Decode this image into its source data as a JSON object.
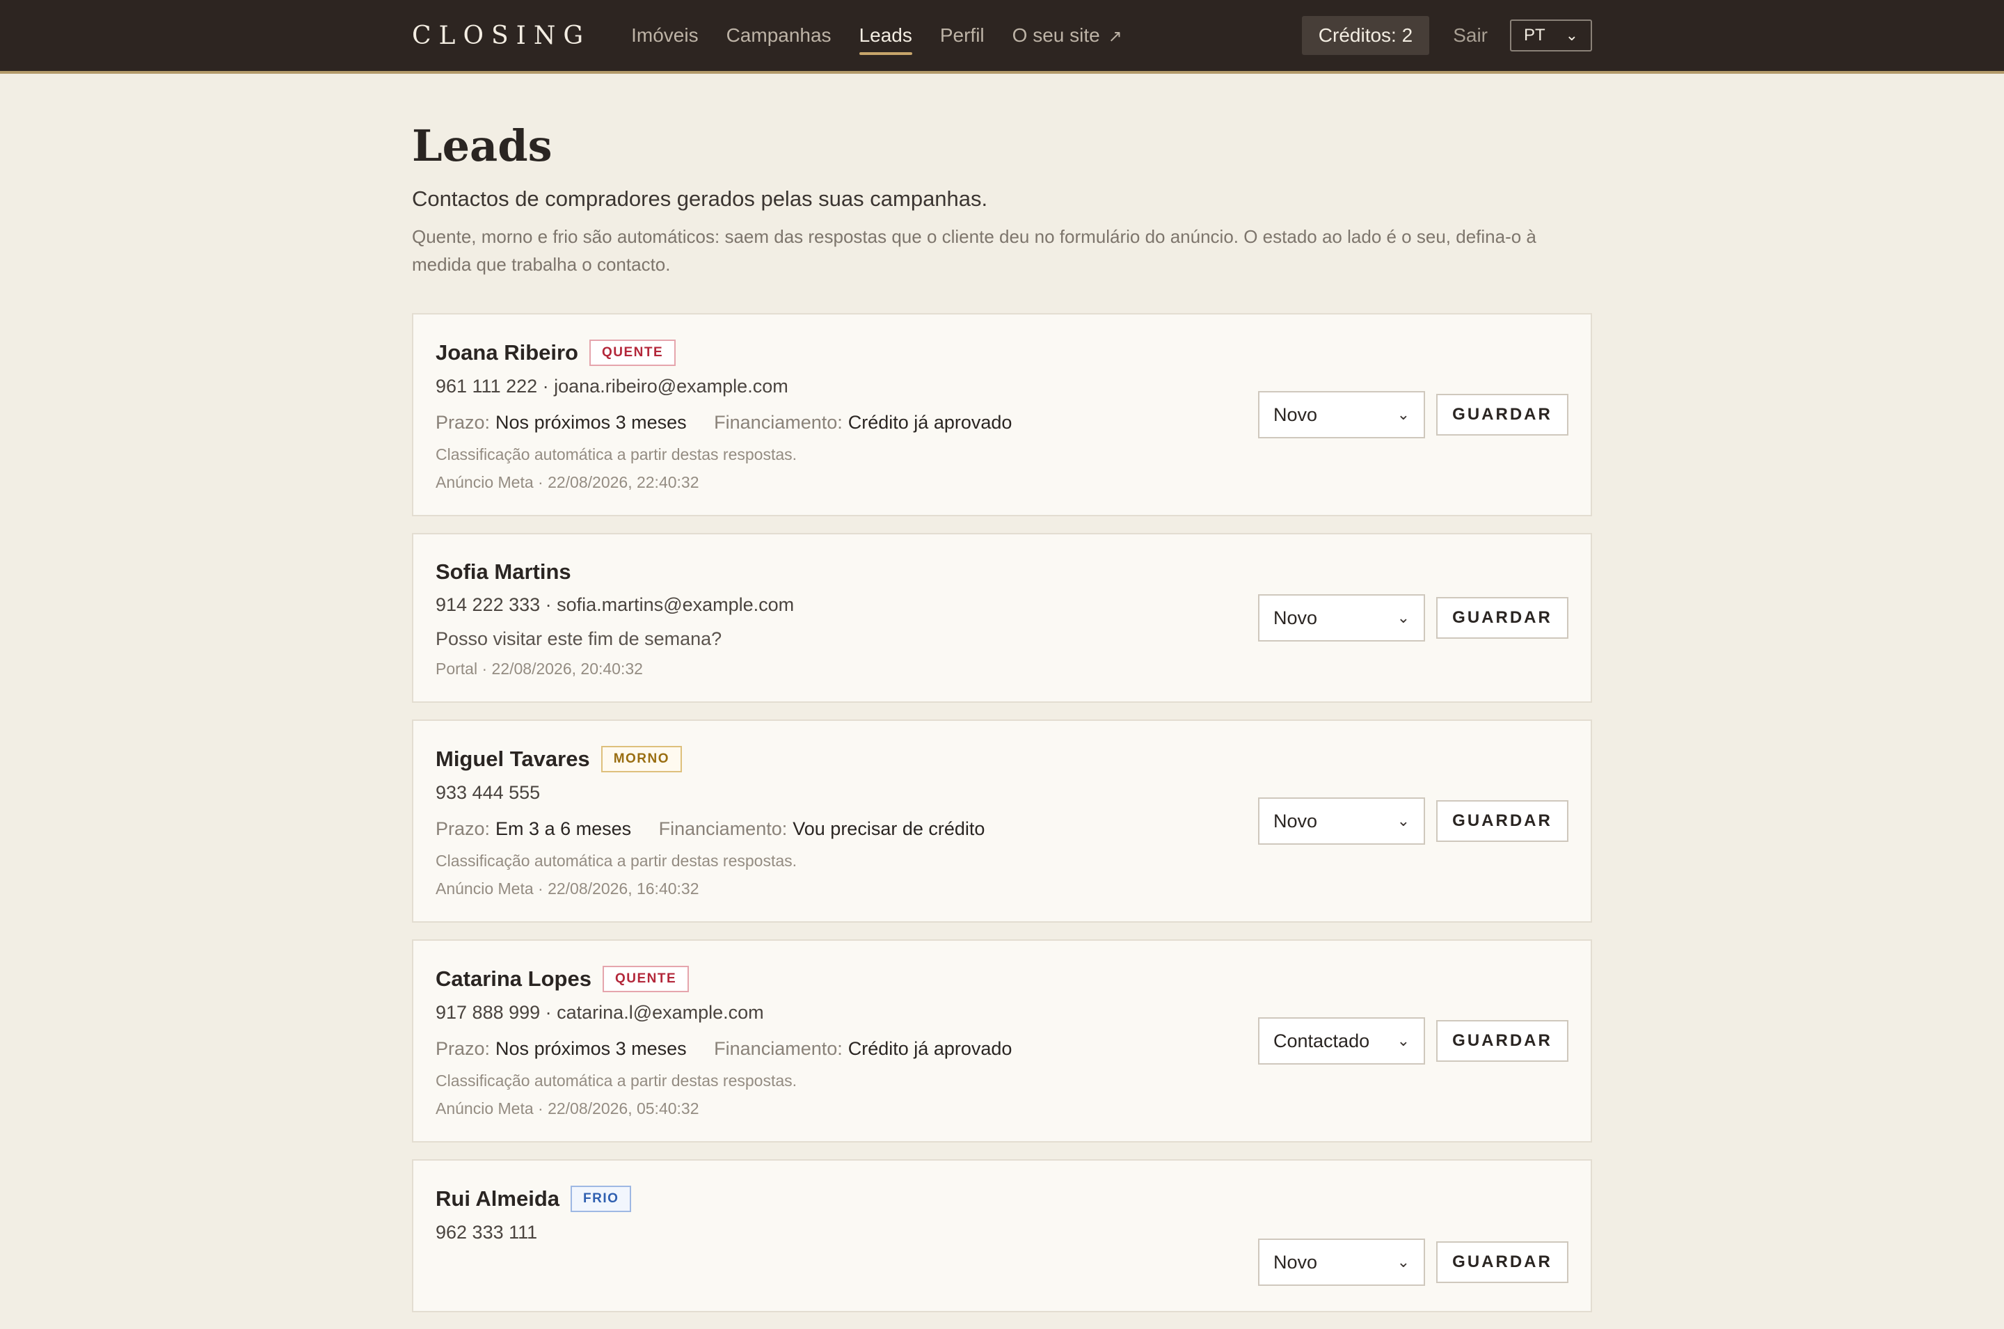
{
  "header": {
    "logo": "CLOSING",
    "nav": [
      {
        "label": "Imóveis",
        "active": false
      },
      {
        "label": "Campanhas",
        "active": false
      },
      {
        "label": "Leads",
        "active": true
      },
      {
        "label": "Perfil",
        "active": false
      },
      {
        "label": "O seu site",
        "active": false,
        "external_icon": "↗"
      }
    ],
    "credits": "Créditos: 2",
    "logout": "Sair",
    "language": "PT"
  },
  "page": {
    "title": "Leads",
    "subtitle": "Contactos de compradores gerados pelas suas campanhas.",
    "note": "Quente, morno e frio são automáticos: saem das respostas que o cliente deu no formulário do anúncio. O estado ao lado é o seu, defina-o à medida que trabalha o contacto."
  },
  "labels": {
    "prazo": "Prazo:",
    "financiamento": "Financiamento:",
    "classify_note": "Classificação automática a partir destas respostas.",
    "save": "GUARDAR"
  },
  "leads": [
    {
      "name": "Joana Ribeiro",
      "badge": "QUENTE",
      "contact": "961 111 222 · joana.ribeiro@example.com",
      "prazo": "Nos próximos 3 meses",
      "financiamento": "Crédito já aprovado",
      "meta": "Anúncio Meta · 22/08/2026, 22:40:32",
      "status": "Novo"
    },
    {
      "name": "Sofia Martins",
      "contact": "914 222 333 · sofia.martins@example.com",
      "message": "Posso visitar este fim de semana?",
      "meta": "Portal · 22/08/2026, 20:40:32",
      "status": "Novo"
    },
    {
      "name": "Miguel Tavares",
      "badge": "MORNO",
      "contact": "933 444 555",
      "prazo": "Em 3 a 6 meses",
      "financiamento": "Vou precisar de crédito",
      "meta": "Anúncio Meta · 22/08/2026, 16:40:32",
      "status": "Novo"
    },
    {
      "name": "Catarina Lopes",
      "badge": "QUENTE",
      "contact": "917 888 999 · catarina.l@example.com",
      "prazo": "Nos próximos 3 meses",
      "financiamento": "Crédito já aprovado",
      "meta": "Anúncio Meta · 22/08/2026, 05:40:32",
      "status": "Contactado"
    },
    {
      "name": "Rui Almeida",
      "badge": "FRIO",
      "contact": "962 333 111",
      "status": "Novo"
    }
  ]
}
